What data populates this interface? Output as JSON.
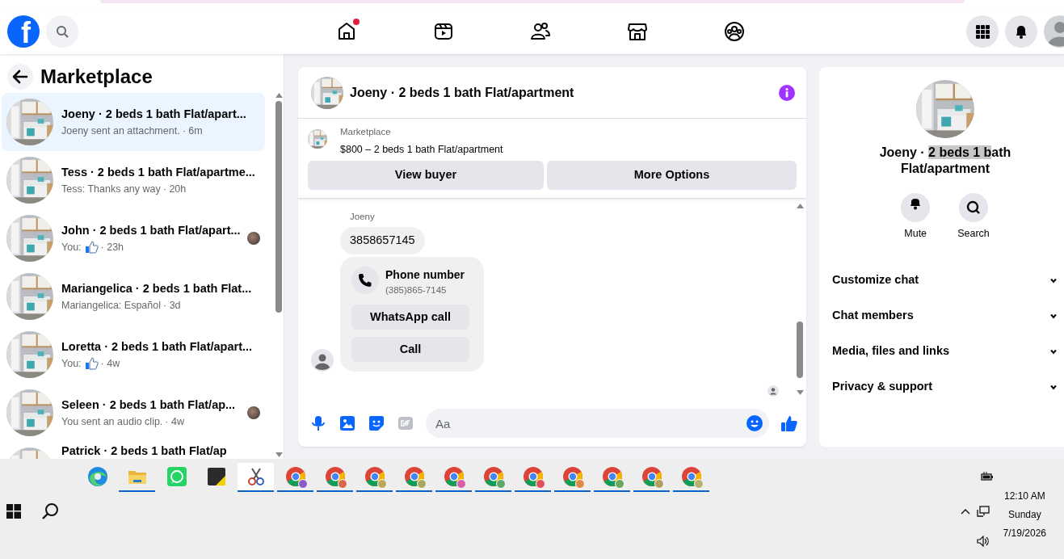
{
  "browser_strip": {
    "kind": "strip"
  },
  "nav": {
    "logo": "f",
    "tabs": [
      {
        "kind": "home",
        "selected": false,
        "notification": true
      },
      {
        "kind": "video",
        "selected": false,
        "notification": false
      },
      {
        "kind": "friends",
        "selected": false,
        "notification": false
      },
      {
        "kind": "marketplace",
        "selected": false,
        "notification": false
      },
      {
        "kind": "groups",
        "selected": false,
        "notification": false
      }
    ]
  },
  "sidebar": {
    "title": "Marketplace",
    "conversations": [
      {
        "title": "Joeny · 2 beds 1 bath Flat/apart...",
        "preview": "Joeny sent an attachment.",
        "time": "· 6m",
        "like": false,
        "seen": false,
        "selected": true
      },
      {
        "title": "Tess · 2 beds 1 bath Flat/apartme...",
        "preview": "Tess: Thanks any way",
        "time": "· 20h",
        "like": false,
        "seen": false,
        "selected": false
      },
      {
        "title": "John · 2 beds 1 bath Flat/apart...",
        "preview": "You:",
        "time": "· 23h",
        "like": true,
        "seen": true,
        "selected": false
      },
      {
        "title": "Mariangelica · 2 beds 1 bath Flat...",
        "preview": "Mariangelica: Español",
        "time": "· 3d",
        "like": false,
        "seen": false,
        "selected": false
      },
      {
        "title": "Loretta · 2 beds 1 bath Flat/apart...",
        "preview": "You:",
        "time": "· 4w",
        "like": true,
        "seen": false,
        "selected": false
      },
      {
        "title": "Seleen · 2 beds 1 bath Flat/ap...",
        "preview": "You sent an audio clip.",
        "time": "· 4w",
        "like": false,
        "seen": true,
        "selected": false
      },
      {
        "title": "Patrick · 2 beds 1 bath Flat/ap",
        "selected": false
      }
    ]
  },
  "chat": {
    "title": "Joeny · 2 beds 1 bath Flat/apartment",
    "listing": {
      "label": "Marketplace",
      "text": "$800 – 2 beds 1 bath Flat/apartment"
    },
    "buttons": [
      "View buyer",
      "More Options"
    ],
    "sender": "Joeny",
    "message": "3858657145",
    "contact_card": {
      "title": "Phone number",
      "number": "(385)865-7145",
      "buttons": [
        "WhatsApp call",
        "Call"
      ]
    },
    "composer": {
      "placeholder": "Aa"
    }
  },
  "details": {
    "title_parts": [
      {
        "text": "Joeny · ",
        "highlighted": false
      },
      {
        "text": "2 beds 1 b",
        "highlighted": true
      },
      {
        "text": "ath Flat/apartment",
        "highlighted": false
      }
    ],
    "actions": [
      {
        "kind": "mute",
        "label": "Mute"
      },
      {
        "kind": "search",
        "label": "Search"
      }
    ],
    "sections": [
      {
        "label": "Customize chat",
        "expanded": false
      },
      {
        "label": "Chat members",
        "expanded": false
      },
      {
        "label": "Media, files and links",
        "expanded": false
      },
      {
        "label": "Privacy & support",
        "expanded": false
      }
    ]
  },
  "taskbar": {
    "apps": [
      {
        "kind": "edge",
        "running": false,
        "selected": false
      },
      {
        "kind": "folder",
        "running": true,
        "selected": false
      },
      {
        "kind": "whatsapp",
        "running": false,
        "selected": false
      },
      {
        "kind": "notes",
        "running": false,
        "selected": false
      },
      {
        "kind": "snip",
        "running": true,
        "selected": true
      },
      {
        "kind": "chrome",
        "color": "#8e5cc8",
        "running": true,
        "selected": false
      },
      {
        "kind": "chrome",
        "color": "#d9694a",
        "running": true,
        "selected": false
      },
      {
        "kind": "chrome",
        "color": "#b8aa5a",
        "running": true,
        "selected": false
      },
      {
        "kind": "chrome",
        "color": "#a8a860",
        "running": true,
        "selected": false
      },
      {
        "kind": "chrome",
        "color": "#d660a8",
        "running": true,
        "selected": false
      },
      {
        "kind": "chrome",
        "color": "#5aa86a",
        "running": true,
        "selected": false
      },
      {
        "kind": "chrome",
        "color": "#e0505a",
        "running": true,
        "selected": false
      },
      {
        "kind": "chrome",
        "color": "#e08a4a",
        "running": true,
        "selected": false
      },
      {
        "kind": "chrome",
        "color": "#6aa860",
        "running": true,
        "selected": false
      },
      {
        "kind": "chrome",
        "color": "#b0a060",
        "running": true,
        "selected": false
      },
      {
        "kind": "chrome",
        "color": "#b8b070",
        "running": true,
        "selected": false
      }
    ],
    "time": "12:10 AM",
    "day": "Sunday",
    "date": "7/19/2026"
  }
}
